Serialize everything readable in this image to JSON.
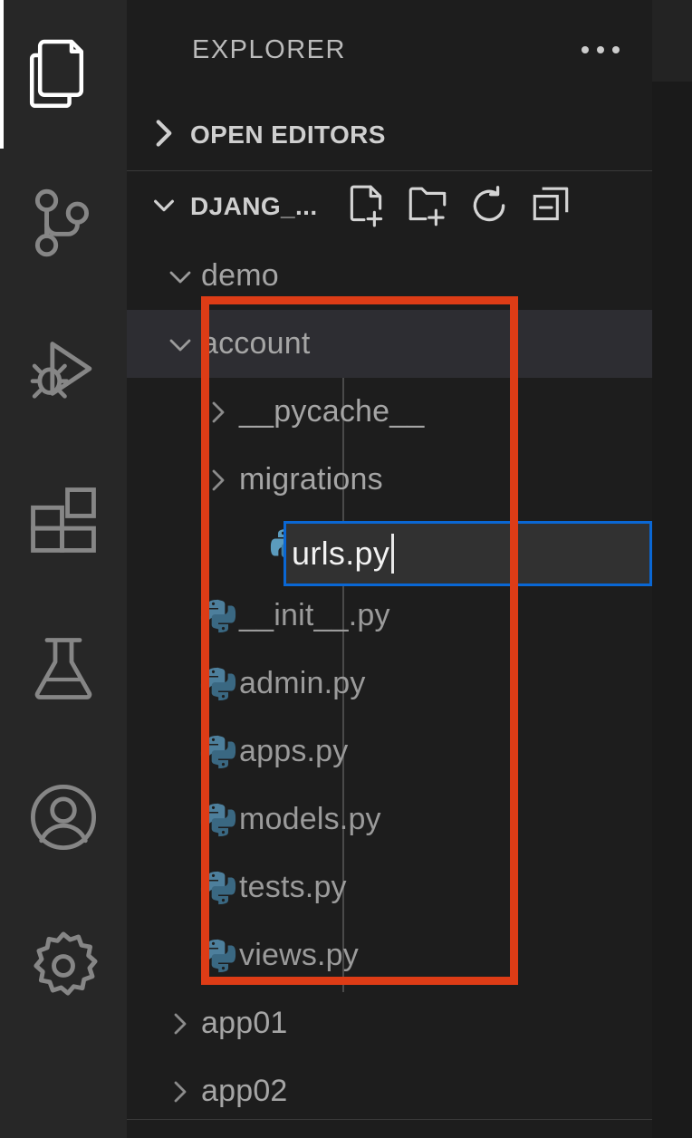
{
  "activity_bar": {
    "items": [
      {
        "name": "explorer",
        "icon": "files-icon",
        "label": "Explorer",
        "active": true
      },
      {
        "name": "source-control",
        "icon": "source-control-icon",
        "label": "Source Control",
        "active": false
      },
      {
        "name": "run-and-debug",
        "icon": "run-debug-icon",
        "label": "Run and Debug",
        "active": false
      },
      {
        "name": "extensions",
        "icon": "extensions-icon",
        "label": "Extensions",
        "active": false
      },
      {
        "name": "testing",
        "icon": "beaker-icon",
        "label": "Testing",
        "active": false
      },
      {
        "name": "accounts",
        "icon": "account-icon",
        "label": "Accounts",
        "active": false
      },
      {
        "name": "settings",
        "icon": "gear-icon",
        "label": "Manage",
        "active": false
      }
    ]
  },
  "sidebar": {
    "title": "EXPLORER",
    "more_actions_label": "Views and More Actions...",
    "sections": [
      {
        "name": "open-editors",
        "label": "OPEN EDITORS",
        "expanded": false,
        "twisty": "chevron-right"
      },
      {
        "name": "workspace-folder",
        "label": "DJANG_...",
        "expanded": true,
        "twisty": "chevron-down"
      }
    ],
    "folder_toolbar": [
      {
        "name": "new-file",
        "icon": "new-file-icon",
        "label": "New File..."
      },
      {
        "name": "new-folder",
        "icon": "new-folder-icon",
        "label": "New Folder..."
      },
      {
        "name": "refresh-explorer",
        "icon": "refresh-icon",
        "label": "Refresh Explorer"
      },
      {
        "name": "collapse-folders",
        "icon": "collapse-all-icon",
        "label": "Collapse Folders in Explorer"
      }
    ]
  },
  "tree": {
    "rows": [
      {
        "name": "demo",
        "type": "folder",
        "twisty": "chevron-down",
        "indent": 1,
        "selected": false,
        "icon": null
      },
      {
        "name": "account",
        "type": "folder",
        "twisty": "chevron-down",
        "indent": 1,
        "selected": true,
        "icon": null
      },
      {
        "name": "__pycache__",
        "type": "folder",
        "twisty": "chevron-right",
        "indent": 2,
        "selected": false,
        "icon": null
      },
      {
        "name": "migrations",
        "type": "folder",
        "twisty": "chevron-right",
        "indent": 2,
        "selected": false,
        "icon": null
      },
      {
        "name": "__init__.py",
        "type": "file",
        "twisty": null,
        "indent": 2,
        "selected": false,
        "icon": "python-icon"
      },
      {
        "name": "admin.py",
        "type": "file",
        "twisty": null,
        "indent": 2,
        "selected": false,
        "icon": "python-icon"
      },
      {
        "name": "apps.py",
        "type": "file",
        "twisty": null,
        "indent": 2,
        "selected": false,
        "icon": "python-icon"
      },
      {
        "name": "models.py",
        "type": "file",
        "twisty": null,
        "indent": 2,
        "selected": false,
        "icon": "python-icon"
      },
      {
        "name": "tests.py",
        "type": "file",
        "twisty": null,
        "indent": 2,
        "selected": false,
        "icon": "python-icon"
      },
      {
        "name": "views.py",
        "type": "file",
        "twisty": null,
        "indent": 2,
        "selected": false,
        "icon": "python-icon"
      },
      {
        "name": "app01",
        "type": "folder",
        "twisty": "chevron-right",
        "indent": 1,
        "selected": false,
        "icon": null
      },
      {
        "name": "app02",
        "type": "folder",
        "twisty": "chevron-right",
        "indent": 1,
        "selected": false,
        "icon": null
      }
    ]
  },
  "rename_input": {
    "value": "urls.py",
    "placeholder": "",
    "file_icon": "python-icon",
    "focused": true
  },
  "annotation": {
    "label": "highlight-box",
    "color": "#dd3c16"
  },
  "colors": {
    "activity_bar_bg": "#272727",
    "sidebar_bg": "#1d1d1d",
    "editor_bg": "#1a1a1a",
    "selected_row_bg": "#2d2d32",
    "input_border": "#0a67d4",
    "input_bg": "#313131",
    "text_primary": "#cccccc",
    "text_dim": "#9b9b9b",
    "python_icon": "#4b8bbe",
    "annotation": "#dd3c16"
  }
}
